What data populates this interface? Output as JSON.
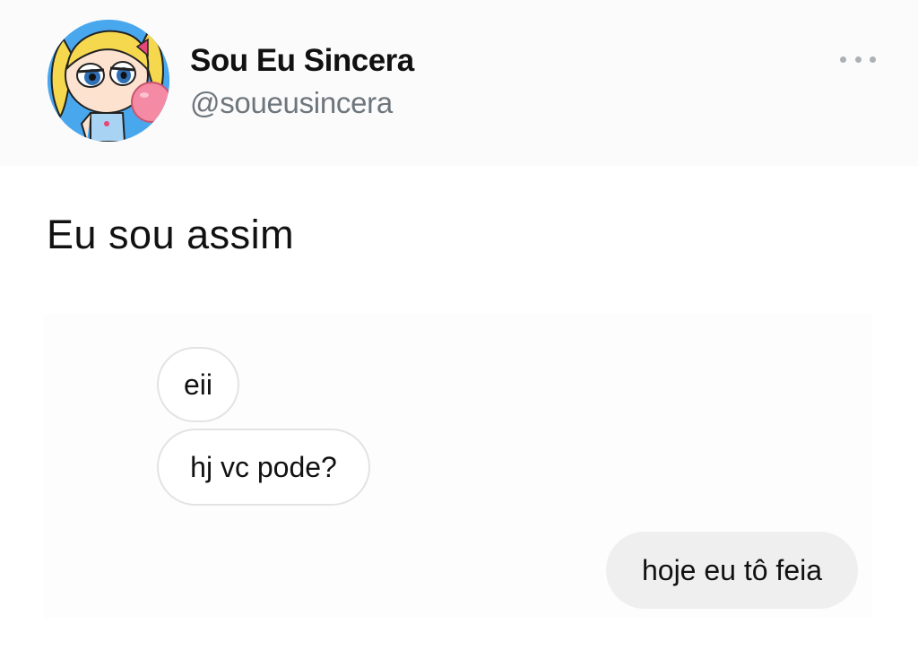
{
  "profile": {
    "display_name": "Sou Eu Sincera",
    "handle": "@soueusincera",
    "avatar_icon": "powerpuff-bubbles-avatar-icon"
  },
  "menu": {
    "icon": "more-options-icon"
  },
  "tweet": {
    "text": "Eu sou assim"
  },
  "chat": {
    "messages": [
      {
        "direction": "incoming",
        "text": "eii"
      },
      {
        "direction": "incoming",
        "text": "hj vc pode?"
      },
      {
        "direction": "outgoing",
        "text": "hoje eu tô feia"
      }
    ]
  },
  "colors": {
    "avatar_background": "#49a7ee",
    "handle_gray": "#6e767d",
    "incoming_bubble_border": "#e3e3e3",
    "outgoing_bubble_fill": "#efefef"
  }
}
